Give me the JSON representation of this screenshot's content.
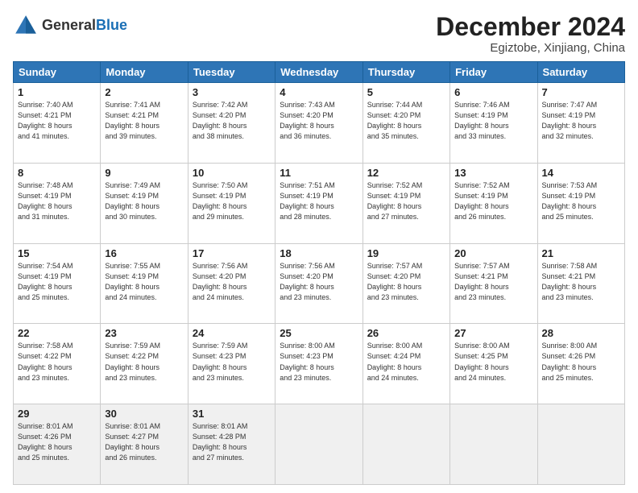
{
  "header": {
    "logo_general": "General",
    "logo_blue": "Blue",
    "title": "December 2024",
    "subtitle": "Egiztobe, Xinjiang, China"
  },
  "days_of_week": [
    "Sunday",
    "Monday",
    "Tuesday",
    "Wednesday",
    "Thursday",
    "Friday",
    "Saturday"
  ],
  "weeks": [
    [
      {
        "day": "1",
        "info": "Sunrise: 7:40 AM\nSunset: 4:21 PM\nDaylight: 8 hours\nand 41 minutes."
      },
      {
        "day": "2",
        "info": "Sunrise: 7:41 AM\nSunset: 4:21 PM\nDaylight: 8 hours\nand 39 minutes."
      },
      {
        "day": "3",
        "info": "Sunrise: 7:42 AM\nSunset: 4:20 PM\nDaylight: 8 hours\nand 38 minutes."
      },
      {
        "day": "4",
        "info": "Sunrise: 7:43 AM\nSunset: 4:20 PM\nDaylight: 8 hours\nand 36 minutes."
      },
      {
        "day": "5",
        "info": "Sunrise: 7:44 AM\nSunset: 4:20 PM\nDaylight: 8 hours\nand 35 minutes."
      },
      {
        "day": "6",
        "info": "Sunrise: 7:46 AM\nSunset: 4:19 PM\nDaylight: 8 hours\nand 33 minutes."
      },
      {
        "day": "7",
        "info": "Sunrise: 7:47 AM\nSunset: 4:19 PM\nDaylight: 8 hours\nand 32 minutes."
      }
    ],
    [
      {
        "day": "8",
        "info": "Sunrise: 7:48 AM\nSunset: 4:19 PM\nDaylight: 8 hours\nand 31 minutes."
      },
      {
        "day": "9",
        "info": "Sunrise: 7:49 AM\nSunset: 4:19 PM\nDaylight: 8 hours\nand 30 minutes."
      },
      {
        "day": "10",
        "info": "Sunrise: 7:50 AM\nSunset: 4:19 PM\nDaylight: 8 hours\nand 29 minutes."
      },
      {
        "day": "11",
        "info": "Sunrise: 7:51 AM\nSunset: 4:19 PM\nDaylight: 8 hours\nand 28 minutes."
      },
      {
        "day": "12",
        "info": "Sunrise: 7:52 AM\nSunset: 4:19 PM\nDaylight: 8 hours\nand 27 minutes."
      },
      {
        "day": "13",
        "info": "Sunrise: 7:52 AM\nSunset: 4:19 PM\nDaylight: 8 hours\nand 26 minutes."
      },
      {
        "day": "14",
        "info": "Sunrise: 7:53 AM\nSunset: 4:19 PM\nDaylight: 8 hours\nand 25 minutes."
      }
    ],
    [
      {
        "day": "15",
        "info": "Sunrise: 7:54 AM\nSunset: 4:19 PM\nDaylight: 8 hours\nand 25 minutes."
      },
      {
        "day": "16",
        "info": "Sunrise: 7:55 AM\nSunset: 4:19 PM\nDaylight: 8 hours\nand 24 minutes."
      },
      {
        "day": "17",
        "info": "Sunrise: 7:56 AM\nSunset: 4:20 PM\nDaylight: 8 hours\nand 24 minutes."
      },
      {
        "day": "18",
        "info": "Sunrise: 7:56 AM\nSunset: 4:20 PM\nDaylight: 8 hours\nand 23 minutes."
      },
      {
        "day": "19",
        "info": "Sunrise: 7:57 AM\nSunset: 4:20 PM\nDaylight: 8 hours\nand 23 minutes."
      },
      {
        "day": "20",
        "info": "Sunrise: 7:57 AM\nSunset: 4:21 PM\nDaylight: 8 hours\nand 23 minutes."
      },
      {
        "day": "21",
        "info": "Sunrise: 7:58 AM\nSunset: 4:21 PM\nDaylight: 8 hours\nand 23 minutes."
      }
    ],
    [
      {
        "day": "22",
        "info": "Sunrise: 7:58 AM\nSunset: 4:22 PM\nDaylight: 8 hours\nand 23 minutes."
      },
      {
        "day": "23",
        "info": "Sunrise: 7:59 AM\nSunset: 4:22 PM\nDaylight: 8 hours\nand 23 minutes."
      },
      {
        "day": "24",
        "info": "Sunrise: 7:59 AM\nSunset: 4:23 PM\nDaylight: 8 hours\nand 23 minutes."
      },
      {
        "day": "25",
        "info": "Sunrise: 8:00 AM\nSunset: 4:23 PM\nDaylight: 8 hours\nand 23 minutes."
      },
      {
        "day": "26",
        "info": "Sunrise: 8:00 AM\nSunset: 4:24 PM\nDaylight: 8 hours\nand 24 minutes."
      },
      {
        "day": "27",
        "info": "Sunrise: 8:00 AM\nSunset: 4:25 PM\nDaylight: 8 hours\nand 24 minutes."
      },
      {
        "day": "28",
        "info": "Sunrise: 8:00 AM\nSunset: 4:26 PM\nDaylight: 8 hours\nand 25 minutes."
      }
    ],
    [
      {
        "day": "29",
        "info": "Sunrise: 8:01 AM\nSunset: 4:26 PM\nDaylight: 8 hours\nand 25 minutes."
      },
      {
        "day": "30",
        "info": "Sunrise: 8:01 AM\nSunset: 4:27 PM\nDaylight: 8 hours\nand 26 minutes."
      },
      {
        "day": "31",
        "info": "Sunrise: 8:01 AM\nSunset: 4:28 PM\nDaylight: 8 hours\nand 27 minutes."
      },
      null,
      null,
      null,
      null
    ]
  ]
}
